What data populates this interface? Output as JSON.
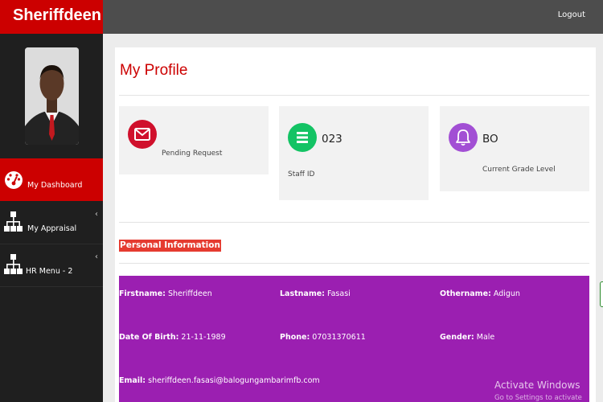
{
  "brand": {
    "name": "Sheriffdeen"
  },
  "header": {
    "logout_label": "Logout"
  },
  "sidebar": {
    "items": [
      {
        "label": "My Dashboard",
        "icon": "dashboard-gauge-icon",
        "active": true
      },
      {
        "label": "My Appraisal",
        "icon": "sitemap-icon",
        "has_submenu": true
      },
      {
        "label": "HR Menu - 2",
        "icon": "sitemap-icon",
        "has_submenu": true
      }
    ],
    "chevron": "‹"
  },
  "page": {
    "title": "My Profile"
  },
  "cards": [
    {
      "value": "",
      "caption": "Pending Request",
      "icon": "envelope-icon",
      "color": "#d0102c"
    },
    {
      "value": "023",
      "caption": "Staff ID",
      "icon": "list-icon",
      "color": "#13c364"
    },
    {
      "value": "BO",
      "caption": "Current Grade Level",
      "icon": "bell-icon",
      "color": "#a24fd4"
    }
  ],
  "personal": {
    "title": "Personal Information",
    "fields": [
      {
        "label": "Firstname:",
        "value": "Sheriffdeen"
      },
      {
        "label": "Lastname:",
        "value": "Fasasi"
      },
      {
        "label": "Othername:",
        "value": "Adigun"
      },
      {
        "label": "Date Of Birth:",
        "value": "21-11-1989"
      },
      {
        "label": "Phone:",
        "value": "07031370611"
      },
      {
        "label": "Gender:",
        "value": "Male"
      },
      {
        "label": "Email:",
        "value": "sheriffdeen.fasasi@balogungambarimfb.com"
      }
    ]
  },
  "watermark": {
    "title": "Activate Windows",
    "subtitle": "Go to Settings to activate Windows."
  },
  "colors": {
    "brand_red": "#cc0000",
    "info_purple": "#9b1fb1",
    "section_red": "#e53b30"
  }
}
